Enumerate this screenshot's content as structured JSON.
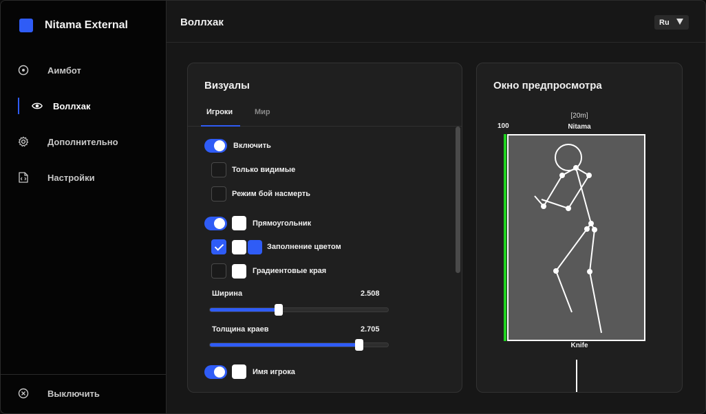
{
  "app": {
    "name": "Nitama External",
    "brand_color": "#2f5cf6"
  },
  "sidebar": {
    "items": [
      {
        "label": "Аимбот",
        "icon": "target-icon"
      },
      {
        "label": "Воллхак",
        "icon": "eye-icon",
        "active": true
      },
      {
        "label": "Дополнительно",
        "icon": "gear-icon"
      },
      {
        "label": "Настройки",
        "icon": "file-code-icon"
      }
    ],
    "bottom": {
      "label": "Выключить",
      "icon": "close-circle-icon"
    }
  },
  "header": {
    "title": "Воллхак",
    "language": "Ru"
  },
  "visuals": {
    "title": "Визуалы",
    "tabs": [
      {
        "label": "Игроки",
        "active": true
      },
      {
        "label": "Мир"
      }
    ],
    "options": {
      "enable": {
        "label": "Включить",
        "on": true
      },
      "only_visible": {
        "label": "Только видимые",
        "checked": false
      },
      "deathmatch": {
        "label": "Режим бой насмерть",
        "checked": false
      },
      "box": {
        "label": "Прямоугольник",
        "on": true,
        "color": "#ffffff"
      },
      "fill": {
        "label": "Заполнение цветом",
        "checked": true,
        "color1": "#ffffff",
        "color2": "#2f5cf6"
      },
      "gradient": {
        "label": "Градиентовые края",
        "checked": false,
        "color": "#ffffff"
      },
      "width": {
        "label": "Ширина",
        "value": "2.508",
        "fraction": 0.387
      },
      "edge_thickness": {
        "label": "Толщина краев",
        "value": "2.705",
        "fraction": 0.838
      },
      "player_name": {
        "label": "Имя игрока",
        "on": true,
        "color": "#ffffff"
      }
    }
  },
  "preview": {
    "title": "Окно предпросмотра",
    "distance": "[20m]",
    "name": "Nitama",
    "health": "100",
    "health_fraction": 1.0,
    "weapon": "Knife",
    "health_color": "#1fd11f",
    "box_color": "#ffffff"
  }
}
